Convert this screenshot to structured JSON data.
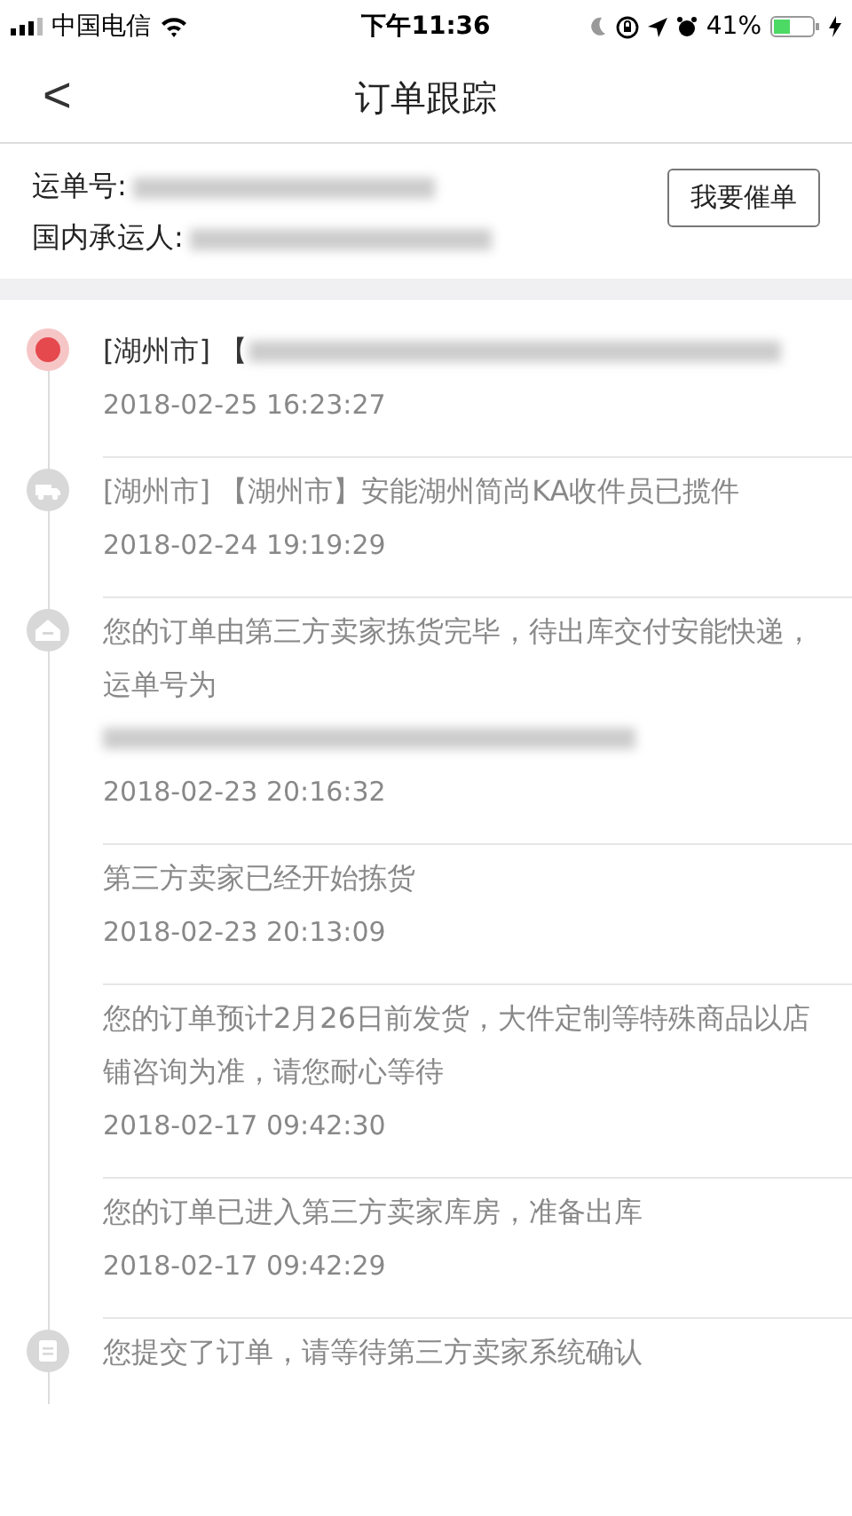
{
  "status_bar": {
    "carrier": "中国电信",
    "time": "下午11:36",
    "battery": "41%"
  },
  "nav": {
    "back": "<",
    "title": "订单跟踪"
  },
  "info": {
    "rows": [
      {
        "label": "运单号:",
        "redacted": true
      },
      {
        "label": "国内承运人:",
        "redacted": true
      }
    ],
    "button": "我要催单"
  },
  "events": [
    {
      "kind": "current",
      "text": "[湖州市] 【",
      "redacted": true,
      "time": "2018-02-25 16:23:27"
    },
    {
      "kind": "truck",
      "text": "[湖州市] 【湖州市】安能湖州简尚KA收件员已揽件",
      "redacted": false,
      "time": "2018-02-24 19:19:29"
    },
    {
      "kind": "house",
      "text": "您的订单由第三方卖家拣货完毕，待出库交付安能快递，运单号为",
      "redacted": true,
      "time": "2018-02-23 20:16:32"
    },
    {
      "kind": "none",
      "text": "第三方卖家已经开始拣货",
      "redacted": false,
      "time": "2018-02-23 20:13:09"
    },
    {
      "kind": "none",
      "text": "您的订单预计2月26日前发货，大件定制等特殊商品以店铺咨询为准，请您耐心等待",
      "redacted": false,
      "time": "2018-02-17 09:42:30"
    },
    {
      "kind": "none",
      "text": "您的订单已进入第三方卖家库房，准备出库",
      "redacted": false,
      "time": "2018-02-17 09:42:29"
    },
    {
      "kind": "clipboard",
      "text": "您提交了订单，请等待第三方卖家系统确认",
      "redacted": false
    }
  ]
}
